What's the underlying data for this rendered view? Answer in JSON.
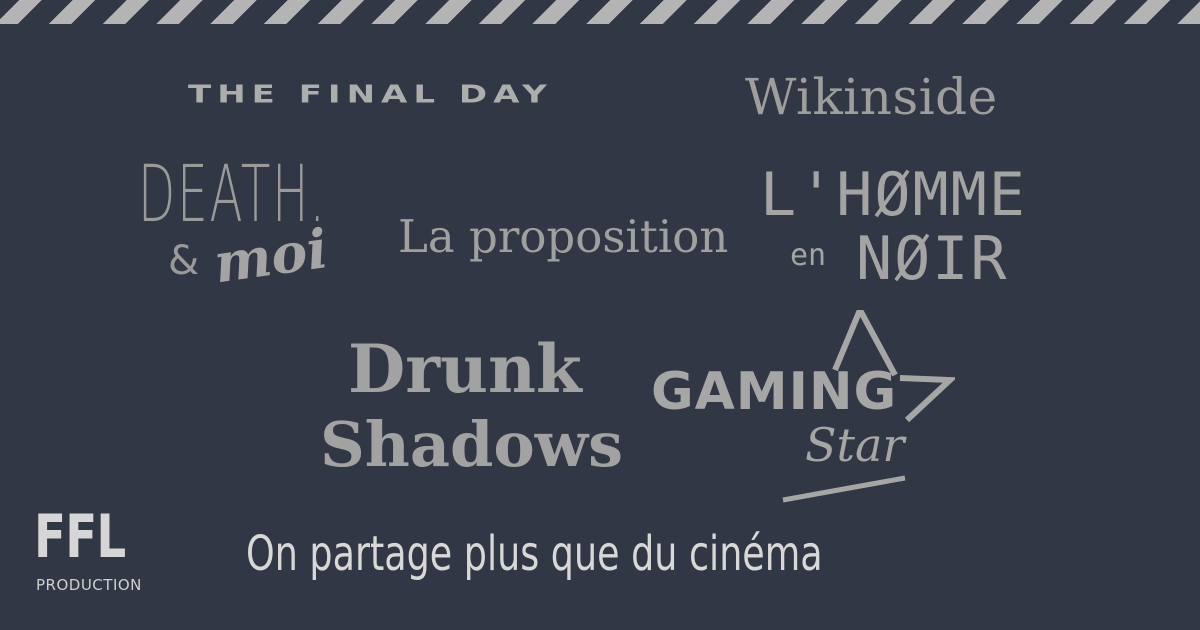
{
  "logos": {
    "final_day": "THE FINAL DAY",
    "wikinside": "Wikinside",
    "death_line1": "DEATH.",
    "death_amp": "&",
    "death_moi": "moi",
    "proposition": "La proposition",
    "homme_line1": "L'HØMME",
    "homme_en": "en",
    "homme_noir": "NØIR",
    "drunk_line1": "Drunk",
    "drunk_line2": "Shadows",
    "gaming_line1": "GAMING",
    "gaming_line2": "Star"
  },
  "brand": {
    "name": "FFL",
    "sub": "PRODUCTION"
  },
  "tagline": "On partage plus que du cinéma",
  "colors": {
    "background": "#323745",
    "stripe": "#b4b4b4",
    "logo_gray": "#a8a8a8",
    "tagline": "#d8d8d8"
  },
  "icons": [
    "star-outline-icon"
  ]
}
